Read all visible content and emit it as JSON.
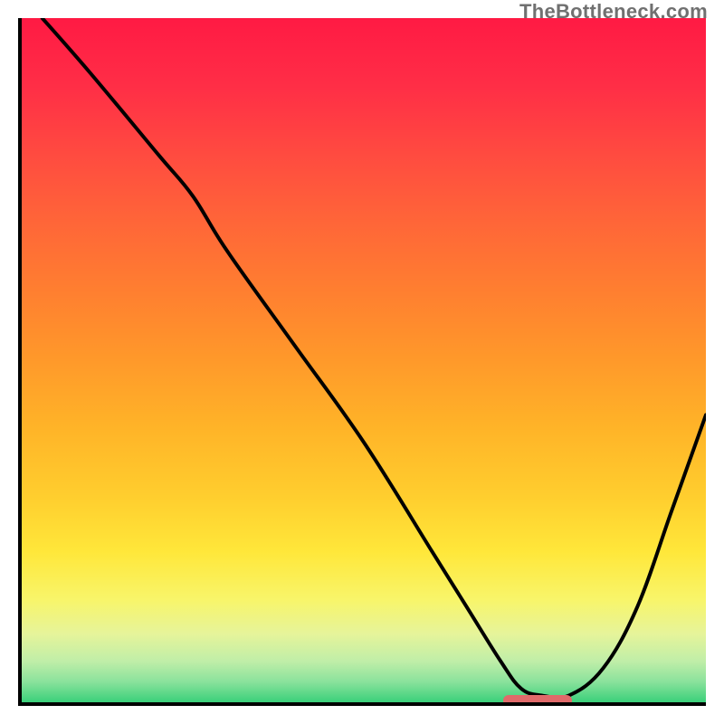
{
  "watermark": "TheBottleneck.com",
  "gradient_stops": [
    {
      "offset": 0,
      "color": "#ff1a44"
    },
    {
      "offset": 0.1,
      "color": "#ff2e46"
    },
    {
      "offset": 0.2,
      "color": "#ff4b40"
    },
    {
      "offset": 0.3,
      "color": "#ff6638"
    },
    {
      "offset": 0.4,
      "color": "#ff7f30"
    },
    {
      "offset": 0.5,
      "color": "#ff992a"
    },
    {
      "offset": 0.6,
      "color": "#ffb428"
    },
    {
      "offset": 0.7,
      "color": "#ffce2e"
    },
    {
      "offset": 0.78,
      "color": "#ffe73a"
    },
    {
      "offset": 0.85,
      "color": "#f8f56a"
    },
    {
      "offset": 0.9,
      "color": "#e6f49a"
    },
    {
      "offset": 0.94,
      "color": "#c0eea8"
    },
    {
      "offset": 0.97,
      "color": "#8ae29c"
    },
    {
      "offset": 1.0,
      "color": "#3ad07a"
    }
  ],
  "chart_data": {
    "type": "line",
    "title": "",
    "xlabel": "",
    "ylabel": "",
    "xlim": [
      0,
      100
    ],
    "ylim": [
      0,
      100
    ],
    "x": [
      3,
      10,
      20,
      25,
      30,
      40,
      50,
      60,
      65,
      70,
      73,
      76,
      80,
      85,
      90,
      95,
      100
    ],
    "values": [
      100,
      92,
      80,
      74,
      66,
      52,
      38,
      22,
      14,
      6,
      2,
      1,
      1,
      5,
      14,
      28,
      42
    ],
    "marker_range_x": [
      70,
      80
    ],
    "marker_y": 0.8
  }
}
